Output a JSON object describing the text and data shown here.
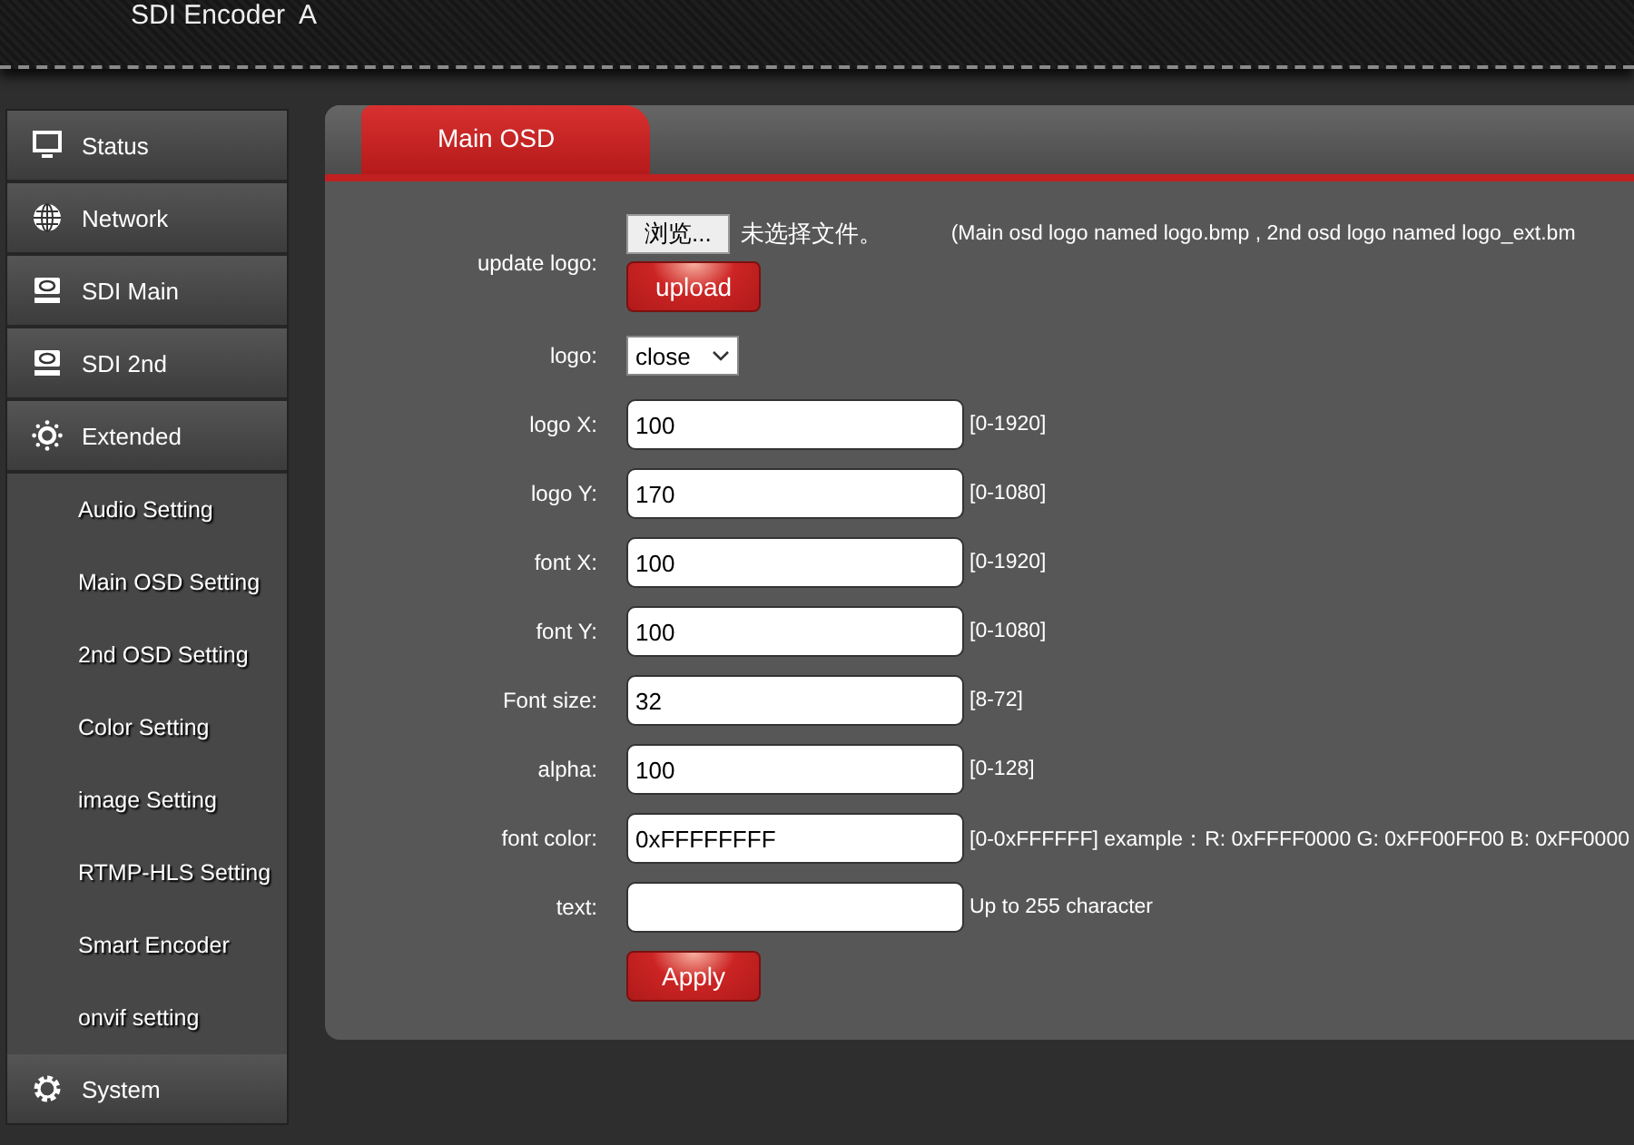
{
  "header": {
    "title": "SDI Encoder  A"
  },
  "sidebar": {
    "items": [
      {
        "label": "Status",
        "kind": "main"
      },
      {
        "label": "Network",
        "kind": "main"
      },
      {
        "label": "SDI Main",
        "kind": "main"
      },
      {
        "label": "SDI 2nd",
        "kind": "main"
      },
      {
        "label": "Extended",
        "kind": "main"
      },
      {
        "label": "Audio Setting",
        "kind": "sub"
      },
      {
        "label": "Main OSD Setting",
        "kind": "sub"
      },
      {
        "label": "2nd OSD Setting",
        "kind": "sub"
      },
      {
        "label": "Color Setting",
        "kind": "sub"
      },
      {
        "label": "image Setting",
        "kind": "sub"
      },
      {
        "label": "RTMP-HLS Setting",
        "kind": "sub"
      },
      {
        "label": "Smart Encoder",
        "kind": "sub"
      },
      {
        "label": "onvif setting",
        "kind": "sub"
      },
      {
        "label": "System",
        "kind": "main"
      }
    ]
  },
  "tabs": [
    {
      "label": "Main OSD",
      "selected": true
    }
  ],
  "form": {
    "rows": [
      {
        "kind": "file",
        "label": "update logo:",
        "browse": "浏览...",
        "file_status": "未选择文件。",
        "hint": "(Main osd logo named logo.bmp , 2nd osd logo named logo_ext.bm",
        "upload": "upload"
      },
      {
        "kind": "select",
        "label": "logo:",
        "value": "close"
      },
      {
        "kind": "input",
        "label": "logo X:",
        "value": "100",
        "hint": "[0-1920]"
      },
      {
        "kind": "input",
        "label": "logo Y:",
        "value": "170",
        "hint": "[0-1080]"
      },
      {
        "kind": "input",
        "label": "font X:",
        "value": "100",
        "hint": "[0-1920]"
      },
      {
        "kind": "input",
        "label": "font Y:",
        "value": "100",
        "hint": "[0-1080]"
      },
      {
        "kind": "input",
        "label": "Font size:",
        "value": "32",
        "hint": "[8-72]"
      },
      {
        "kind": "input",
        "label": "alpha:",
        "value": "100",
        "hint": "[0-128]"
      },
      {
        "kind": "input",
        "label": "font color:",
        "value": "0xFFFFFFFF",
        "hint": "[0-0xFFFFFF] example：R: 0xFFFF0000 G: 0xFF00FF00 B: 0xFF0000"
      },
      {
        "kind": "input",
        "label": "text:",
        "value": "",
        "hint": "Up to 255 character"
      }
    ],
    "apply": "Apply"
  }
}
